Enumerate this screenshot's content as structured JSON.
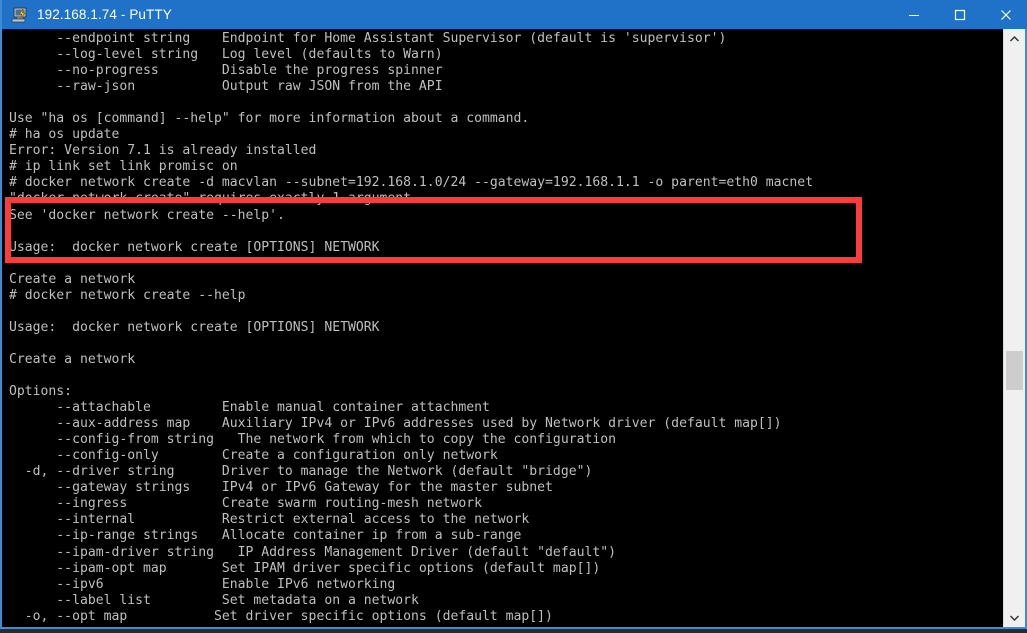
{
  "window": {
    "title": "192.168.1.74 - PuTTY",
    "icon": "putty-computer-icon",
    "accent_color": "#1f72c8",
    "border_color": "#3f8cd4",
    "controls": {
      "minimize_label": "Minimize",
      "maximize_label": "Maximize",
      "close_label": "Close"
    }
  },
  "terminal": {
    "background_color": "#000000",
    "foreground_color": "#bfbfbf",
    "content": "      --endpoint string    Endpoint for Home Assistant Supervisor (default is 'supervisor')\n      --log-level string   Log level (defaults to Warn)\n      --no-progress        Disable the progress spinner\n      --raw-json           Output raw JSON from the API\n\nUse \"ha os [command] --help\" for more information about a command.\n# ha os update\nError: Version 7.1 is already installed\n# ip link set link promisc on\n# docker network create -d macvlan --subnet=192.168.1.0/24 --gateway=192.168.1.1 -o parent=eth0 macnet\n\"docker network create\" requires exactly 1 argument.\nSee 'docker network create --help'.\n\nUsage:  docker network create [OPTIONS] NETWORK\n\nCreate a network\n# docker network create --help\n\nUsage:  docker network create [OPTIONS] NETWORK\n\nCreate a network\n\nOptions:\n      --attachable         Enable manual container attachment\n      --aux-address map    Auxiliary IPv4 or IPv6 addresses used by Network driver (default map[])\n      --config-from string   The network from which to copy the configuration\n      --config-only        Create a configuration only network\n  -d, --driver string      Driver to manage the Network (default \"bridge\")\n      --gateway strings    IPv4 or IPv6 Gateway for the master subnet\n      --ingress            Create swarm routing-mesh network\n      --internal           Restrict external access to the network\n      --ip-range strings   Allocate container ip from a sub-range\n      --ipam-driver string   IP Address Management Driver (default \"default\")\n      --ipam-opt map       Set IPAM driver specific options (default map[])\n      --ipv6               Enable IPv6 networking\n      --label list         Set metadata on a network\n  -o, --opt map           Set driver specific options (default map[])"
  },
  "annotation": {
    "highlight_color": "#fa3c3c",
    "highlighted_lines": [
      "# docker network create -d macvlan --subnet=192.168.1.0/24 --gateway=192.168.1.1 -o parent=eth0 macnet",
      "\"docker network create\" requires exactly 1 argument.",
      "See 'docker network create --help'."
    ]
  },
  "scrollbar": {
    "track_color": "#f0f0f0",
    "thumb_color": "#cdcdcd",
    "up_arrow": "scroll-up-arrow-icon",
    "down_arrow": "scroll-down-arrow-icon"
  }
}
